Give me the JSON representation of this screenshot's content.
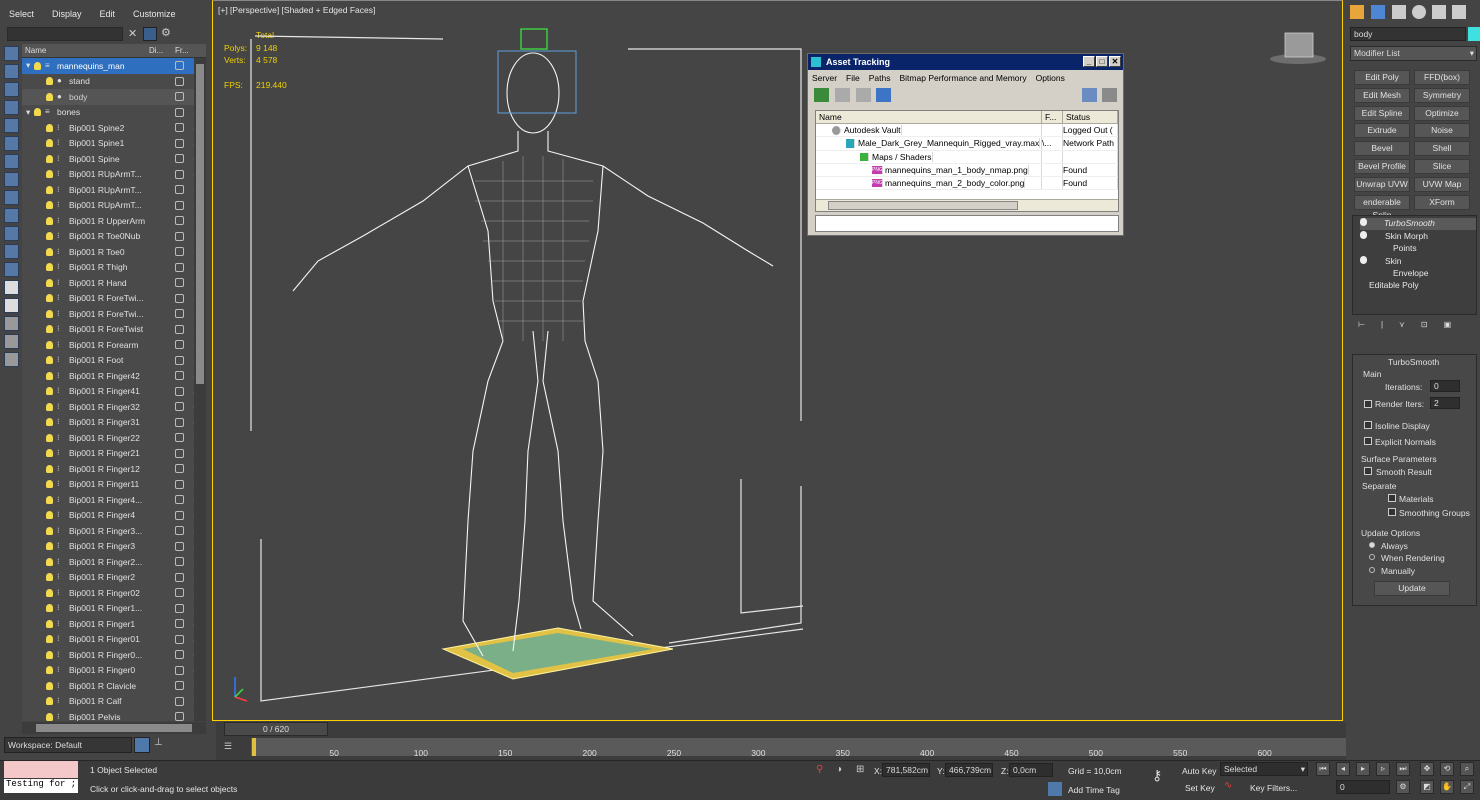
{
  "explorer": {
    "menu": [
      "Select",
      "Display",
      "Edit",
      "Customize"
    ],
    "columns": {
      "name": "Name",
      "display": "Di...",
      "freeze": "Fr..."
    },
    "rows": [
      "mannequins_man",
      "stand",
      "body",
      "bones",
      "Bip001 Spine2",
      "Bip001 Spine1",
      "Bip001 Spine",
      "Bip001 RUpArmT...",
      "Bip001 RUpArmT...",
      "Bip001 RUpArmT...",
      "Bip001 R UpperArm",
      "Bip001 R Toe0Nub",
      "Bip001 R Toe0",
      "Bip001 R Thigh",
      "Bip001 R Hand",
      "Bip001 R ForeTwi...",
      "Bip001 R ForeTwi...",
      "Bip001 R ForeTwist",
      "Bip001 R Forearm",
      "Bip001 R Foot",
      "Bip001 R Finger42",
      "Bip001 R Finger41",
      "Bip001 R Finger32",
      "Bip001 R Finger31",
      "Bip001 R Finger22",
      "Bip001 R Finger21",
      "Bip001 R Finger12",
      "Bip001 R Finger11",
      "Bip001 R Finger4...",
      "Bip001 R Finger4",
      "Bip001 R Finger3...",
      "Bip001 R Finger3",
      "Bip001 R Finger2...",
      "Bip001 R Finger2",
      "Bip001 R Finger02",
      "Bip001 R Finger1...",
      "Bip001 R Finger1",
      "Bip001 R Finger01",
      "Bip001 R Finger0...",
      "Bip001 R Finger0",
      "Bip001 R Clavicle",
      "Bip001 R Calf",
      "Bip001 Pelvis"
    ],
    "workspace": "Workspace: Default"
  },
  "viewport": {
    "label": "[+] [Perspective] [Shaded + Edged Faces]",
    "stats": {
      "total_label": "Total",
      "polys_label": "Polys:",
      "polys": "9 148",
      "verts_label": "Verts:",
      "verts": "4 578",
      "fps_label": "FPS:",
      "fps": "219.440"
    }
  },
  "asset_tracking": {
    "title": "Asset Tracking",
    "menu": [
      "Server",
      "File",
      "Paths",
      "Bitmap Performance and Memory",
      "Options"
    ],
    "columns": [
      "Name",
      "F...",
      "Status"
    ],
    "rows": [
      {
        "name": "Autodesk Vault",
        "f": "",
        "status": "Logged Out ("
      },
      {
        "name": "Male_Dark_Grey_Mannequin_Rigged_vray.max",
        "f": "\\...",
        "status": "Network Path"
      },
      {
        "name": "Maps / Shaders",
        "f": "",
        "status": ""
      },
      {
        "name": "mannequins_man_1_body_nmap.png",
        "f": "",
        "status": "Found"
      },
      {
        "name": "mannequins_man_2_body_color.png",
        "f": "",
        "status": "Found"
      }
    ],
    "png_badge": "PNG"
  },
  "command_panel": {
    "object_name": "body",
    "modifier_list": "Modifier List",
    "buttons": [
      [
        "Edit Poly",
        "FFD(box)"
      ],
      [
        "Edit Mesh",
        "Symmetry"
      ],
      [
        "Edit Spline",
        "Optimize"
      ],
      [
        "Extrude",
        "Noise"
      ],
      [
        "Bevel",
        "Shell"
      ],
      [
        "Bevel Profile",
        "Slice"
      ],
      [
        "Unwrap UVW",
        "UVW Map"
      ],
      [
        "enderable Splin",
        "XForm"
      ]
    ],
    "stack": [
      "TurboSmooth",
      "Skin Morph",
      "Points",
      "Skin",
      "Envelope",
      "Editable Poly"
    ],
    "rollout": {
      "title": "TurboSmooth",
      "main": "Main",
      "iterations_label": "Iterations:",
      "iterations": "0",
      "render_iters_label": "Render Iters:",
      "render_iters": "2",
      "isoline": "Isoline Display",
      "explicit_normals": "Explicit Normals",
      "surface_params": "Surface Parameters",
      "smooth_result": "Smooth Result",
      "separate": "Separate",
      "materials": "Materials",
      "smoothing_groups": "Smoothing Groups",
      "update_options": "Update Options",
      "always": "Always",
      "when_rendering": "When Rendering",
      "manually": "Manually",
      "update": "Update"
    }
  },
  "timeline": {
    "frame": "0 / 620",
    "ticks": [
      "50",
      "100",
      "150",
      "200",
      "250",
      "300",
      "350",
      "400",
      "450",
      "500",
      "550",
      "600"
    ]
  },
  "status": {
    "script": "Testing for ;",
    "selected": "1 Object Selected",
    "prompt": "Click or click-and-drag to select objects",
    "x_label": "X:",
    "x": "781,582cm",
    "y_label": "Y:",
    "y": "466,739cm",
    "z_label": "Z:",
    "z": "0,0cm",
    "grid": "Grid = 10,0cm",
    "add_time_tag": "Add Time Tag",
    "auto_key": "Auto Key",
    "set_key": "Set Key",
    "selected_dropdown": "Selected",
    "key_filters": "Key Filters...",
    "current_frame": "0"
  }
}
